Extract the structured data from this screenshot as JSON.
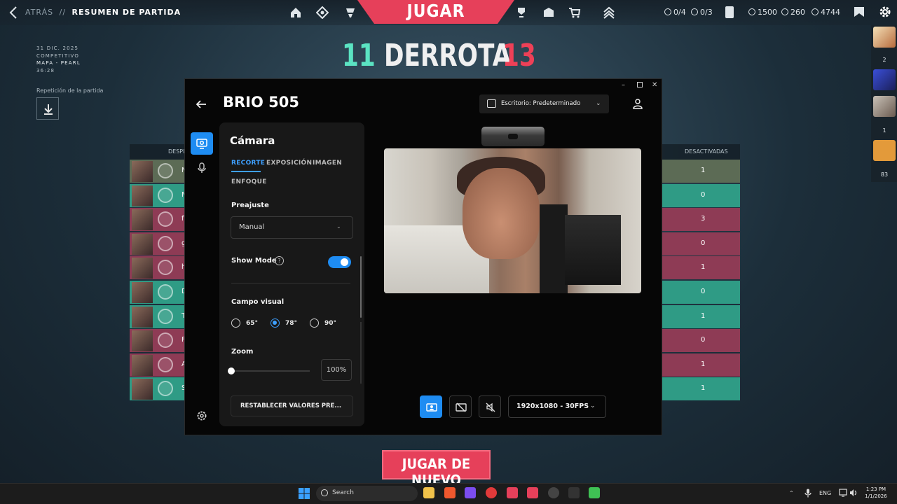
{
  "topbar": {
    "back_label": "ATRÁS",
    "separator": "//",
    "page_title": "RESUMEN DE PARTIDA",
    "play_label": "JUGAR",
    "stats": [
      "0/4",
      "0/3",
      "1500",
      "260",
      "4744"
    ]
  },
  "match": {
    "score_left": "11",
    "result": "DERROTA",
    "score_right": "13",
    "date": "31 DIC. 2025",
    "mode": "COMPETITIVO",
    "map": "MAPA - PEARL",
    "duration": "36:28",
    "replay_label": "Repetición de la partida"
  },
  "scoreboard": {
    "col_left": "DESPL",
    "col_right": "DESACTIVADAS",
    "rows": [
      {
        "name": "N",
        "value": "1",
        "team": "#5c6b55"
      },
      {
        "name": "N",
        "value": "0",
        "team": "#2f9b85"
      },
      {
        "name": "f",
        "value": "3",
        "team": "#8e3b55"
      },
      {
        "name": "g",
        "value": "0",
        "team": "#8e3b55"
      },
      {
        "name": "h",
        "value": "1",
        "team": "#8e3b55"
      },
      {
        "name": "D",
        "value": "0",
        "team": "#2f9b85"
      },
      {
        "name": "T",
        "value": "1",
        "team": "#2f9b85"
      },
      {
        "name": "F",
        "value": "0",
        "team": "#8e3b55"
      },
      {
        "name": "A",
        "value": "1",
        "team": "#8e3b55"
      },
      {
        "name": "S",
        "value": "1",
        "team": "#2f9b85"
      }
    ]
  },
  "party": {
    "counts": [
      "2",
      "1",
      "83"
    ]
  },
  "logi": {
    "device_title": "BRIO 505",
    "scene_label": "Escritorio: Predeterminado",
    "panel_title": "Cámara",
    "tabs": [
      "RECORTE",
      "EXPOSICIÓN",
      "IMAGEN",
      "ENFOQUE"
    ],
    "preset_label": "Preajuste",
    "preset_value": "Manual",
    "show_mode_label": "Show Mode",
    "show_mode_on": true,
    "fov_label": "Campo visual",
    "fov_options": [
      "65°",
      "78°",
      "90°"
    ],
    "fov_selected": "78°",
    "zoom_label": "Zoom",
    "zoom_value": "100%",
    "reset_label": "RESTABLECER VALORES PRE...",
    "resolution": "1920x1080 - 30FPS",
    "help_glyph": "?"
  },
  "play_again_label": "JUGAR DE NUEVO",
  "taskbar": {
    "search_placeholder": "Search",
    "language": "ENG",
    "time": "1:23 PM",
    "date": "1/1/2026"
  },
  "colors": {
    "accent_blue": "#1e8cf2",
    "valorant_red": "#e6405a",
    "win_teal": "#5be3c2",
    "loss_red": "#ee4057"
  }
}
